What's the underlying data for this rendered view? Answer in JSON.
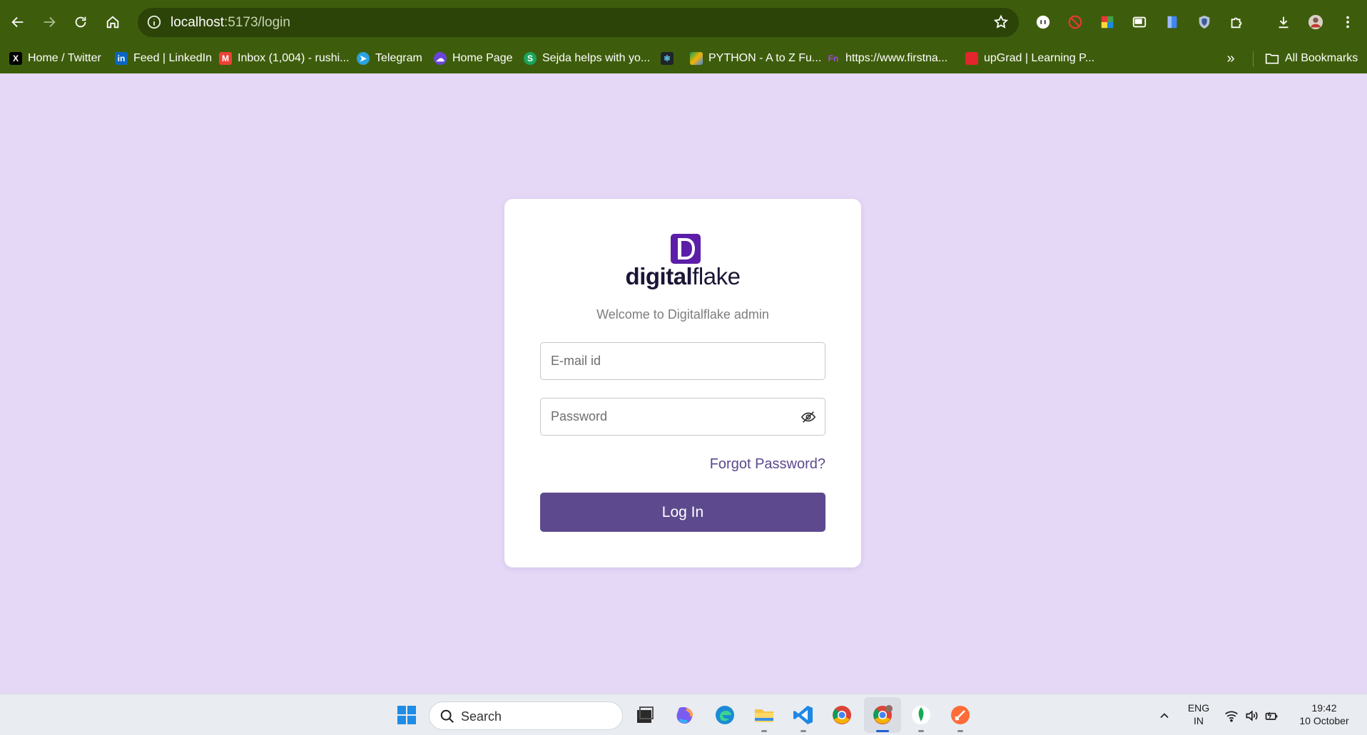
{
  "browser": {
    "url_host": "localhost",
    "url_rest": ":5173/login",
    "bookmarks": [
      {
        "label": "Home / Twitter",
        "icon": "x-twitter-icon",
        "color": "#000000"
      },
      {
        "label": "Feed | LinkedIn",
        "icon": "linkedin-icon",
        "color": "#0a66c2"
      },
      {
        "label": "Inbox (1,004) - rushi...",
        "icon": "gmail-icon",
        "color": "#ea4335"
      },
      {
        "label": "Telegram",
        "icon": "telegram-icon",
        "color": "#2aa3df"
      },
      {
        "label": "Home Page",
        "icon": "cloud-icon",
        "color": "#6a45d9"
      },
      {
        "label": "Sejda helps with yo...",
        "icon": "sejda-icon",
        "color": "#1aa55c"
      },
      {
        "label": "PYTHON - A to Z Fu...",
        "icon": "drive-icon",
        "color": "#f4b400"
      },
      {
        "label": "https://www.firstna...",
        "icon": "firstnaukri-icon",
        "color": "#6b2fbf"
      },
      {
        "label": "upGrad | Learning P...",
        "icon": "upgrad-icon",
        "color": "#e3262e"
      }
    ],
    "all_bookmarks_label": "All Bookmarks"
  },
  "login": {
    "brand_bold": "digital",
    "brand_light": "flake",
    "welcome": "Welcome to Digitalflake admin",
    "email_placeholder": "E-mail id",
    "password_placeholder": "Password",
    "forgot_label": "Forgot Password?",
    "login_label": "Log In",
    "brand_color": "#5c1ea8",
    "button_color": "#5d4a8e",
    "background_color": "#e5d8f6"
  },
  "taskbar": {
    "search_label": "Search",
    "lang_top": "ENG",
    "lang_bottom": "IN",
    "time": "19:42",
    "date": "10 October"
  }
}
